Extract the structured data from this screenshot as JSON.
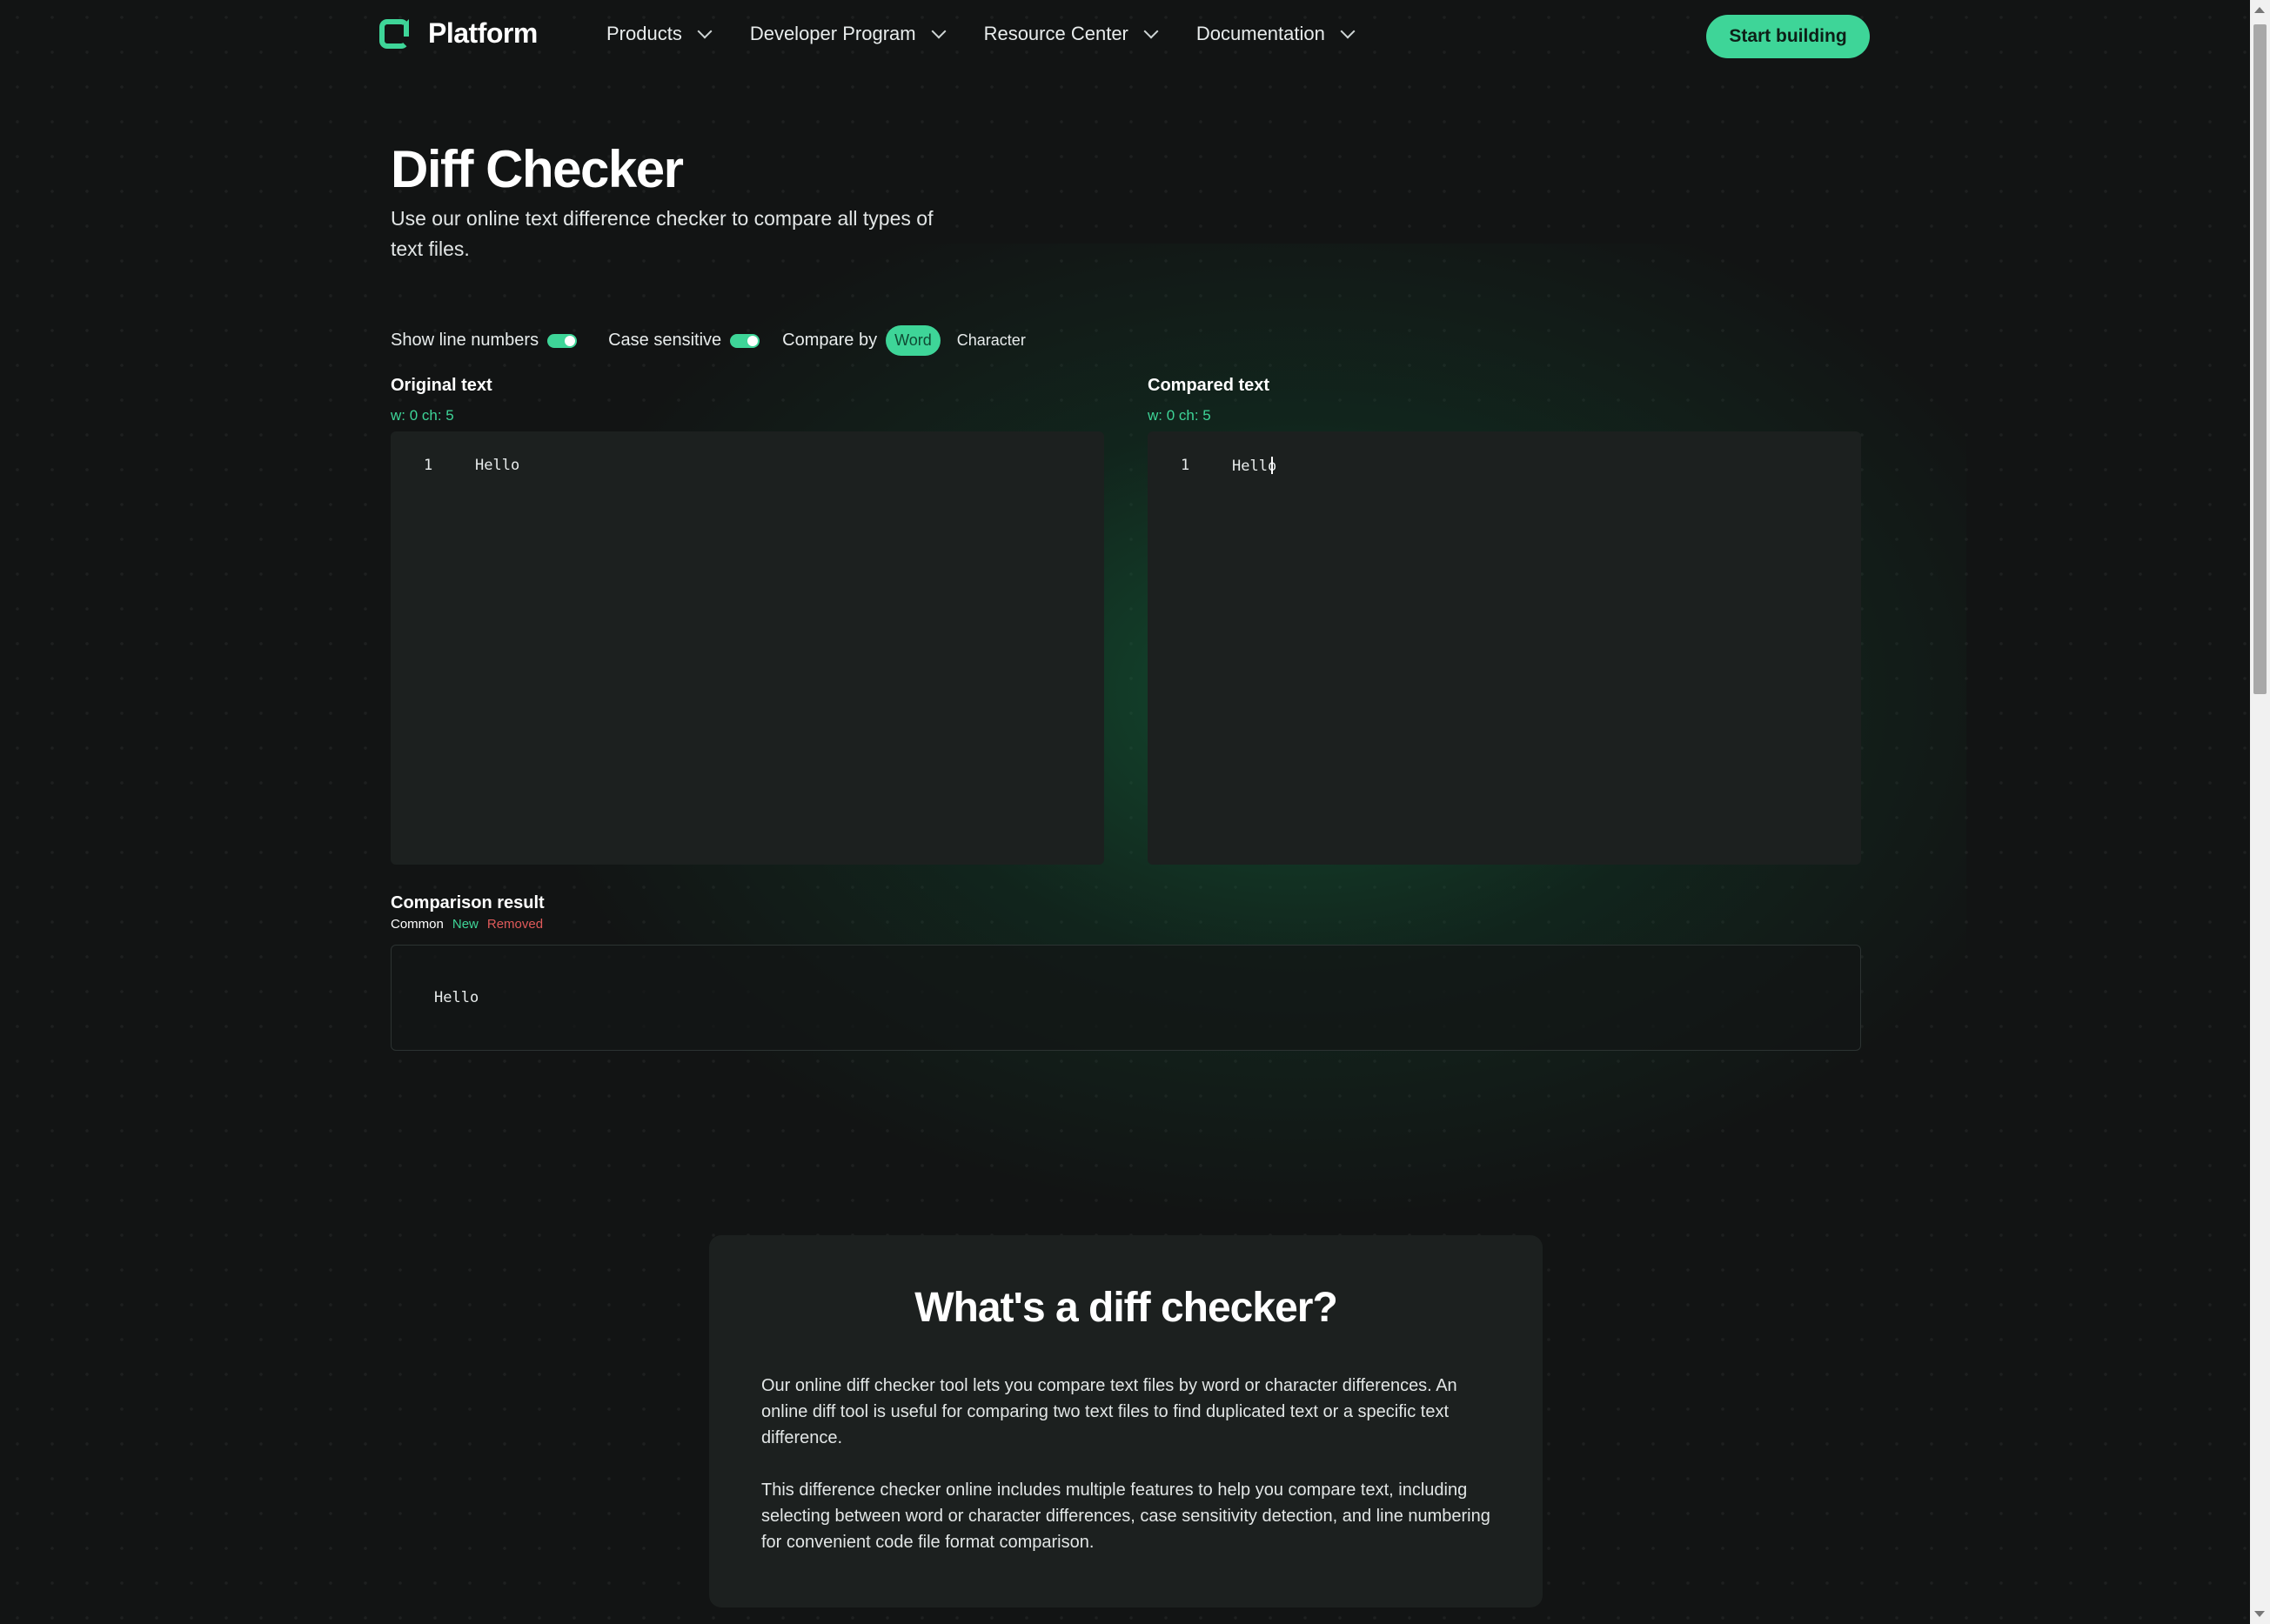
{
  "header": {
    "logo_text": "Platform",
    "nav": [
      {
        "label": "Products"
      },
      {
        "label": "Developer Program"
      },
      {
        "label": "Resource Center"
      },
      {
        "label": "Documentation"
      }
    ],
    "cta_label": "Start building"
  },
  "hero": {
    "title": "Diff Checker",
    "subtitle": "Use our online text difference checker to compare all types of text files."
  },
  "controls": {
    "show_line_numbers_label": "Show line numbers",
    "show_line_numbers_on": true,
    "case_sensitive_label": "Case sensitive",
    "case_sensitive_on": true,
    "compare_by_label": "Compare by",
    "options": [
      "Word",
      "Character"
    ],
    "selected": "Word"
  },
  "original": {
    "label": "Original text",
    "count": "w: 0 ch: 5",
    "line_number": "1",
    "text": "Hello"
  },
  "compared": {
    "label": "Compared text",
    "count": "w: 0 ch: 5",
    "line_number": "1",
    "text": "Hello"
  },
  "result": {
    "title": "Comparison result",
    "legend": {
      "common": "Common",
      "new": "New",
      "removed": "Removed"
    },
    "text": "Hello"
  },
  "info": {
    "title": "What's a diff checker?",
    "p1": "Our online diff checker tool lets you compare text files by word or character differences. An online diff tool is useful for comparing two text files to find duplicated text or a specific text difference.",
    "p2": "This difference checker online includes multiple features to help you compare text, including selecting between word or character differences, case sensitivity detection, and line numbering for convenient code file format comparison."
  },
  "colors": {
    "accent": "#3ed598",
    "background": "#121414",
    "panel": "#1c201f",
    "removed": "#e05a5a"
  },
  "icons": {
    "logo": "platform-logo-icon",
    "nav_chevron": "chevron-down-icon"
  }
}
